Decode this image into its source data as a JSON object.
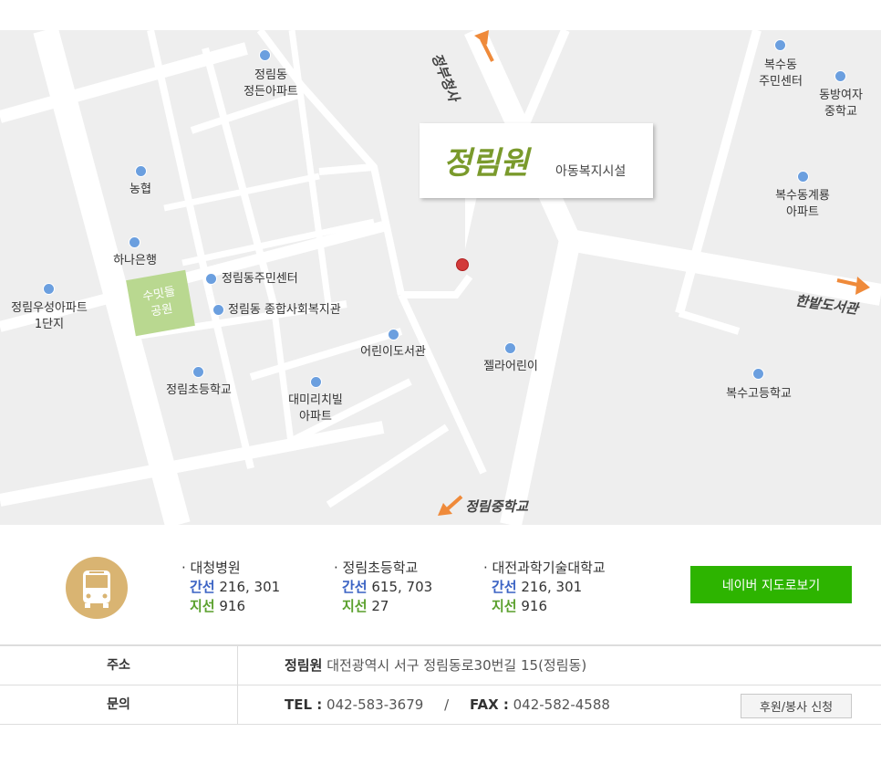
{
  "map": {
    "brand": "정림원",
    "brand_sub": "아동복지시설",
    "park_line1": "수밋들",
    "park_line2": "공원",
    "directions": {
      "north": "정부청사",
      "east": "한밭도서관",
      "south": "정림중학교"
    },
    "pois": [
      {
        "id": "jeongrim-apt",
        "label": "정림동\n정든아파트"
      },
      {
        "id": "nonghyup",
        "label": "농협"
      },
      {
        "id": "hana-bank",
        "label": "하나은행"
      },
      {
        "id": "jeongrim-center",
        "label": "정림동주민센터"
      },
      {
        "id": "welfare-center",
        "label": "정림동 종합사회복지관"
      },
      {
        "id": "useong-apt",
        "label": "정림우성아파트\n1단지"
      },
      {
        "id": "elementary",
        "label": "정림초등학교"
      },
      {
        "id": "daemirichi",
        "label": "대미리치빌\n아파트"
      },
      {
        "id": "child-library",
        "label": "어린이도서관"
      },
      {
        "id": "jella",
        "label": "젤라어린이"
      },
      {
        "id": "boksu-center",
        "label": "복수동\n주민센터"
      },
      {
        "id": "dongbang",
        "label": "동방여자\n중학교"
      },
      {
        "id": "boksu-apt",
        "label": "복수동계룡\n아파트"
      },
      {
        "id": "boksu-high",
        "label": "복수고등학교"
      }
    ]
  },
  "transit": {
    "stops": [
      {
        "name": "· 대청병원",
        "trunk_label": "간선",
        "trunk": "216, 301",
        "branch_label": "지선",
        "branch": "916"
      },
      {
        "name": "· 정림초등학교",
        "trunk_label": "간선",
        "trunk": "615, 703",
        "branch_label": "지선",
        "branch": "27"
      },
      {
        "name": "· 대전과학기술대학교",
        "trunk_label": "간선",
        "trunk": "216, 301",
        "branch_label": "지선",
        "branch": "916"
      }
    ],
    "naver_button": "네이버 지도로보기"
  },
  "info": {
    "address_label": "주소",
    "address_name": "정림원",
    "address": "대전광역시 서구 정림동로30번길 15(정림동)",
    "contact_label": "문의",
    "tel_label": "TEL :",
    "tel": "042-583-3679",
    "separator": "/",
    "fax_label": "FAX :",
    "fax": "042-582-4588",
    "donate_button": "후원/봉사 신청"
  },
  "colors": {
    "map_bg": "#eeeeee",
    "road": "#ffffff",
    "poi": "#6b9fdf",
    "pin": "#d23b3b",
    "arrow": "#ef8a3a",
    "brand": "#7a9a2c",
    "naver": "#2db400",
    "trunk": "#3b63c4",
    "branch": "#5aa02c",
    "bus_icon": "#d9b472"
  }
}
